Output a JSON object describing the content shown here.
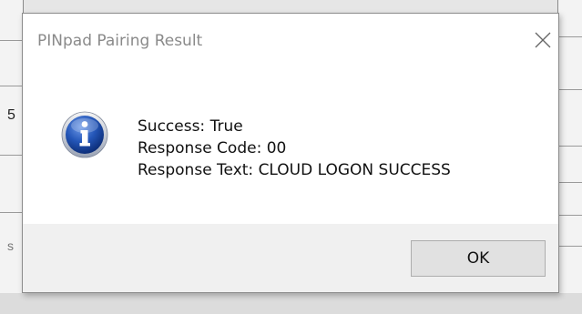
{
  "background": {
    "left_fragment_1": "5",
    "left_fragment_2": "s"
  },
  "dialog": {
    "title": "PINpad Pairing Result",
    "close_icon": "close-icon",
    "icon": "info-icon",
    "message_lines": [
      "Success: True",
      "Response Code: 00",
      "Response Text: CLOUD LOGON SUCCESS"
    ],
    "ok_label": "OK"
  },
  "colors": {
    "info_icon_blue": "#1d4fa8",
    "footer_bg": "#f0f0f0",
    "button_bg": "#e1e1e1"
  }
}
